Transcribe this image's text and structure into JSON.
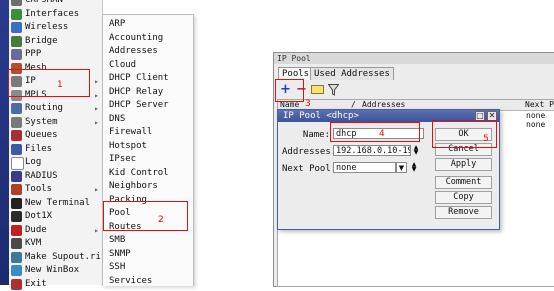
{
  "main_menu": {
    "items": [
      {
        "label": "CAPsMAN",
        "icon": "capsman-icon",
        "color": "#6e6e6e"
      },
      {
        "label": "Interfaces",
        "icon": "interfaces-icon",
        "color": "#3b8f3b"
      },
      {
        "label": "Wireless",
        "icon": "wireless-icon",
        "color": "#3a6fc4"
      },
      {
        "label": "Bridge",
        "icon": "bridge-icon",
        "color": "#4a7a3a"
      },
      {
        "label": "PPP",
        "icon": "ppp-icon",
        "color": "#6a6a9a"
      },
      {
        "label": "Mesh",
        "icon": "mesh-icon",
        "color": "#b05030"
      },
      {
        "label": "IP",
        "icon": "ip-icon",
        "color": "#7a7a7a",
        "arrow": true
      },
      {
        "label": "MPLS",
        "icon": "mpls-icon",
        "color": "#8a8a8a",
        "arrow": true
      },
      {
        "label": "Routing",
        "icon": "routing-icon",
        "color": "#4c6aa8",
        "arrow": true
      },
      {
        "label": "System",
        "icon": "system-icon",
        "color": "#7a7a7a",
        "arrow": true
      },
      {
        "label": "Queues",
        "icon": "queues-icon",
        "color": "#a83030"
      },
      {
        "label": "Files",
        "icon": "files-icon",
        "color": "#3c5aa8"
      },
      {
        "label": "Log",
        "icon": "log-icon",
        "color": "#ffffff"
      },
      {
        "label": "RADIUS",
        "icon": "radius-icon",
        "color": "#3a3a8a"
      },
      {
        "label": "Tools",
        "icon": "tools-icon",
        "color": "#b04020",
        "arrow": true
      },
      {
        "label": "New Terminal",
        "icon": "terminal-icon",
        "color": "#222222"
      },
      {
        "label": "Dot1X",
        "icon": "dot1x-icon",
        "color": "#2a2a2a"
      },
      {
        "label": "Dude",
        "icon": "dude-icon",
        "color": "#c02020",
        "arrow": true
      },
      {
        "label": "KVM",
        "icon": "kvm-icon",
        "color": "#4a4a4a"
      },
      {
        "label": "Make Supout.rif",
        "icon": "supout-icon",
        "color": "#3a7a9a"
      },
      {
        "label": "New WinBox",
        "icon": "winbox-icon",
        "color": "#3a8ac4"
      },
      {
        "label": "Exit",
        "icon": "exit-icon",
        "color": "#b03030"
      }
    ]
  },
  "sub_menu": {
    "items": [
      "ARP",
      "Accounting",
      "Addresses",
      "Cloud",
      "DHCP Client",
      "DHCP Relay",
      "DHCP Server",
      "DNS",
      "Firewall",
      "Hotspot",
      "IPsec",
      "Kid Control",
      "Neighbors",
      "Packing",
      "Pool",
      "Routes",
      "SMB",
      "SNMP",
      "SSH",
      "Services"
    ]
  },
  "annotations": {
    "n1": "1",
    "n2": "2",
    "n3": "3",
    "n4": "4",
    "n5": "5"
  },
  "pool_window": {
    "title": "IP Pool",
    "tabs": [
      "Pools",
      "Used Addresses"
    ],
    "toolbar_icons": [
      "add-icon",
      "remove-icon",
      "comment-icon",
      "filter-icon"
    ],
    "columns": [
      "Name",
      "/",
      "Addresses",
      "Next Po"
    ],
    "rows": [
      {
        "next_pool": "none"
      },
      {
        "next_pool": "none"
      }
    ]
  },
  "dialog": {
    "title": "IP Pool <dhcp>",
    "name_label": "Name:",
    "name_value": "dhcp",
    "addresses_label": "Addresses:",
    "addresses_value": "192.168.0.10-192",
    "next_pool_label": "Next Pool:",
    "next_pool_value": "none",
    "buttons": {
      "ok": "OK",
      "cancel": "Cancel",
      "apply": "Apply",
      "comment": "Comment",
      "copy": "Copy",
      "remove": "Remove"
    }
  },
  "colors": {
    "annotation": "#e01010",
    "title_bar": "#3e5297",
    "add": "#1c3fc4",
    "remove": "#d01818"
  }
}
